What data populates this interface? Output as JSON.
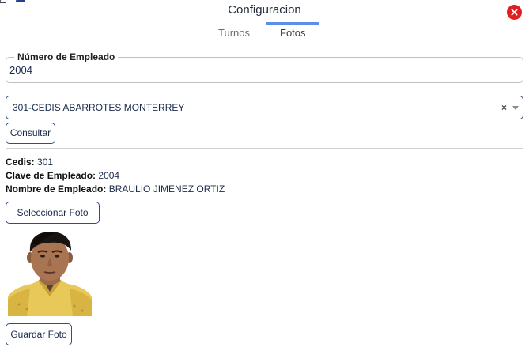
{
  "window": {
    "title": "Configuracion"
  },
  "tabs": [
    {
      "label": "Turnos"
    },
    {
      "label": "Fotos"
    }
  ],
  "employee_field": {
    "legend": "Número de Empleado",
    "value": "2004"
  },
  "cedis_select": {
    "selected": "301-CEDIS ABARROTES MONTERREY",
    "clear_symbol": "×"
  },
  "buttons": {
    "consultar": "Consultar",
    "seleccionar_foto": "Seleccionar Foto",
    "guardar_foto": "Guardar Foto"
  },
  "info": {
    "cedis_label": "Cedis:",
    "cedis_value": "301",
    "clave_label": "Clave de Empleado:",
    "clave_value": "2004",
    "nombre_label": "Nombre de Empleado:",
    "nombre_value": "BRAULIO JIMENEZ ORTIZ"
  },
  "icons": {
    "close": "close-icon",
    "dropdown": "chevron-down-icon"
  },
  "colors": {
    "accent": "#2a4f8f",
    "tab_indicator": "#5b8ee6",
    "close": "#e02020",
    "shirt": "#e9c85a"
  }
}
